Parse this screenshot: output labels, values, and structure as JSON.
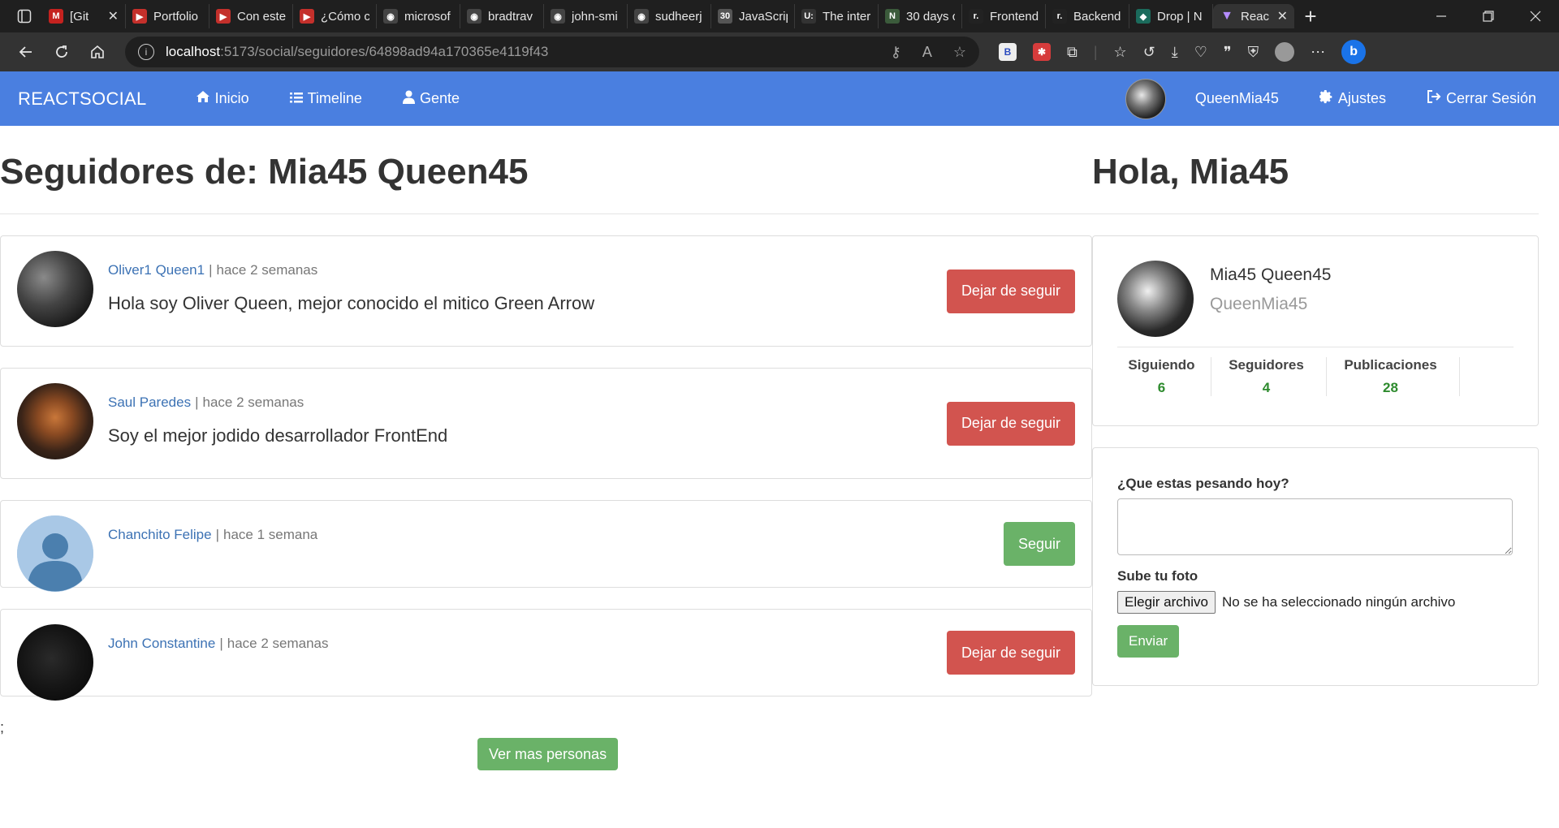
{
  "browser": {
    "tabs": [
      {
        "title": "[Git",
        "color": "#c5221f",
        "glyph": "M",
        "close": "✕"
      },
      {
        "title": "Portfolio",
        "color": "#c4302b",
        "glyph": "▶"
      },
      {
        "title": "Con este",
        "color": "#c4302b",
        "glyph": "▶"
      },
      {
        "title": "¿Cómo c",
        "color": "#c4302b",
        "glyph": "▶"
      },
      {
        "title": "microsof",
        "color": "#444",
        "glyph": "◉"
      },
      {
        "title": "bradtrav",
        "color": "#444",
        "glyph": "◉"
      },
      {
        "title": "john-smi",
        "color": "#444",
        "glyph": "◉"
      },
      {
        "title": "sudheerj",
        "color": "#444",
        "glyph": "◉"
      },
      {
        "title": "JavaScrip",
        "color": "#555",
        "glyph": "30"
      },
      {
        "title": "The inter",
        "color": "#333",
        "glyph": "U:"
      },
      {
        "title": "30 days c",
        "color": "#3b5b3b",
        "glyph": "N"
      },
      {
        "title": "Frontend",
        "color": "#222",
        "glyph": "r."
      },
      {
        "title": "Backend",
        "color": "#222",
        "glyph": "r."
      },
      {
        "title": "Drop | N",
        "color": "#1b6b5c",
        "glyph": "◆"
      }
    ],
    "active_tab": {
      "title": "Reac",
      "glyph": "▼",
      "color": "#9b6bff"
    },
    "close_glyph": "✕",
    "new_tab_glyph": "+",
    "url_host": "localhost",
    "url_path": ":5173/social/seguidores/64898ad94a170365e4119f43"
  },
  "navbar": {
    "brand": "REACTSOCIAL",
    "links": {
      "inicio": "Inicio",
      "timeline": "Timeline",
      "gente": "Gente"
    },
    "user": "QueenMia45",
    "ajustes": "Ajustes",
    "logout": "Cerrar Sesión",
    "color": "#4a7fe0"
  },
  "main": {
    "title": "Seguidores de: Mia45 Queen45",
    "people": [
      {
        "name": "Oliver1 Queen1",
        "time": "hace 2 semanas",
        "bio": "Hola soy Oliver Queen, mejor conocido el mitico Green Arrow",
        "action": "Dejar de seguir"
      },
      {
        "name": "Saul Paredes",
        "time": "hace 2 semanas",
        "bio": "Soy el mejor jodido desarrollador FrontEnd",
        "action": "Dejar de seguir"
      },
      {
        "name": "Chanchito Felipe",
        "time": "hace 1 semana",
        "bio": "",
        "action": "Seguir"
      },
      {
        "name": "John Constantine",
        "time": "hace 2 semanas",
        "bio": "",
        "action": "Dejar de seguir"
      }
    ],
    "separator": "|",
    "stray_text": ";",
    "more_button": "Ver mas personas"
  },
  "sidebar": {
    "greeting": "Hola, Mia45",
    "profile": {
      "name": "Mia45 Queen45",
      "nick": "QueenMia45",
      "stats": [
        {
          "label": "Siguiendo",
          "value": "6"
        },
        {
          "label": "Seguidores",
          "value": "4"
        },
        {
          "label": "Publicaciones",
          "value": "28"
        }
      ]
    },
    "form": {
      "question": "¿Que estas pesando hoy?",
      "photo_label": "Sube tu foto",
      "file_button": "Elegir archivo",
      "file_status": "No se ha seleccionado ningún archivo",
      "submit": "Enviar"
    }
  }
}
